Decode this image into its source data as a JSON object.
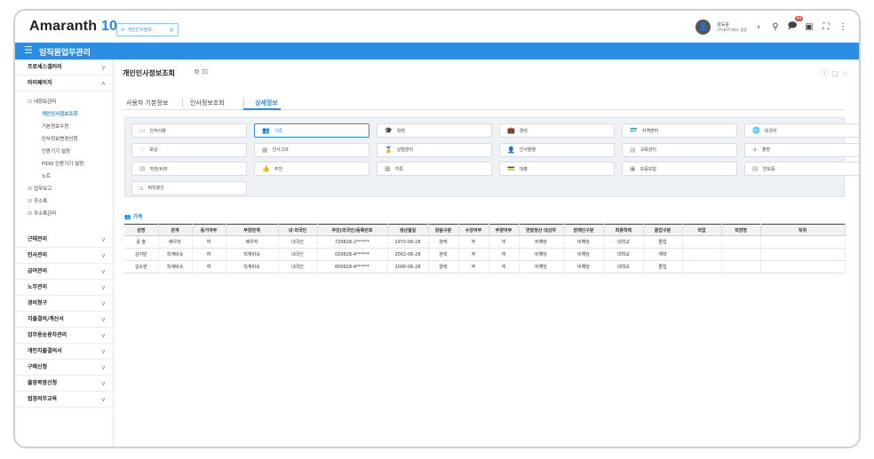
{
  "app": {
    "logo_text": "Amaranth",
    "logo_num": "10"
  },
  "open_tab": {
    "label": "개인인사정보···",
    "close": "×"
  },
  "user": {
    "name": "김도윤",
    "company": "(주)포르디퍼스 팀원",
    "avatar_icon": "user-icon",
    "notification_badge": "99"
  },
  "header": {
    "title": "임직원업무관리"
  },
  "sidebar": {
    "items": [
      {
        "label": "프로세스갤러리"
      },
      {
        "label": "마이페이지"
      },
      {
        "label": "근태관리"
      },
      {
        "label": "인사관리"
      },
      {
        "label": "급여관리"
      },
      {
        "label": "노무관리"
      },
      {
        "label": "경비청구"
      },
      {
        "label": "지출결의/계산서"
      },
      {
        "label": "업무용승용차관리"
      },
      {
        "label": "개인지출결의서"
      },
      {
        "label": "구매신청"
      },
      {
        "label": "출장복명신청"
      },
      {
        "label": "법정의무교육"
      }
    ],
    "subitems": {
      "info_manage": "내정보관리",
      "personal_info": "개인인사정보조회",
      "basic_edit": "기본정보수정",
      "change_req": "인사정보변경신청",
      "auth_device": "인증기기 설정",
      "fido": "FIDO 인증기기 설정",
      "note": "노트",
      "work_report": "업무보고",
      "address": "주소록",
      "address_manage": "주소록관리"
    }
  },
  "page": {
    "title": "개인인사정보조회"
  },
  "tabs": [
    {
      "label": "사용자 기본정보"
    },
    {
      "label": "인사정보조회"
    },
    {
      "label": "상세정보"
    }
  ],
  "buttons": [
    {
      "label": "인적사항"
    },
    {
      "label": "가족"
    },
    {
      "label": "학력"
    },
    {
      "label": "경력"
    },
    {
      "label": "자격면허"
    },
    {
      "label": "외국어"
    },
    {
      "label": "포상"
    },
    {
      "label": "인사고과"
    },
    {
      "label": "상벌관리"
    },
    {
      "label": "인사발령"
    },
    {
      "label": "교육관리"
    },
    {
      "label": "출장"
    },
    {
      "label": "여권/비자"
    },
    {
      "label": "추천"
    },
    {
      "label": "지족"
    },
    {
      "label": "대출"
    },
    {
      "label": "보증보험"
    },
    {
      "label": "연보증"
    },
    {
      "label": "퇴직정산"
    }
  ],
  "family": {
    "section_title": "가족",
    "columns": [
      "성명",
      "관계",
      "동거여부",
      "부양관계",
      "내·외국인",
      "주민(외국인)등록번호",
      "생년월일",
      "양음구분",
      "수당여부",
      "부양여부",
      "연말정산 대상자",
      "장애인구분",
      "최종학력",
      "졸업구분",
      "직업",
      "직장명",
      "직위"
    ],
    "rows": [
      [
        "윤 솔",
        "배우자",
        "여",
        "배우자",
        "내국인",
        "720628-2******",
        "1972-06-28",
        "양력",
        "부",
        "여",
        "비해당",
        "비해당",
        "대학교",
        "졸업",
        "",
        "",
        ""
      ],
      [
        "김지민",
        "직계비속",
        "여",
        "직계비속",
        "내국인",
        "020628-4******",
        "2002-06-28",
        "양력",
        "부",
        "여",
        "비해당",
        "비해당",
        "대학교",
        "재학",
        "",
        "",
        ""
      ],
      [
        "김소현",
        "직계비속",
        "여",
        "직계비속",
        "내국인",
        "000628-4******",
        "2000-06-28",
        "양력",
        "부",
        "여",
        "비해당",
        "비해당",
        "대학교",
        "졸업",
        "",
        "",
        ""
      ]
    ]
  },
  "colors": {
    "accent": "#2b8de3",
    "badge": "#e64b3c"
  }
}
